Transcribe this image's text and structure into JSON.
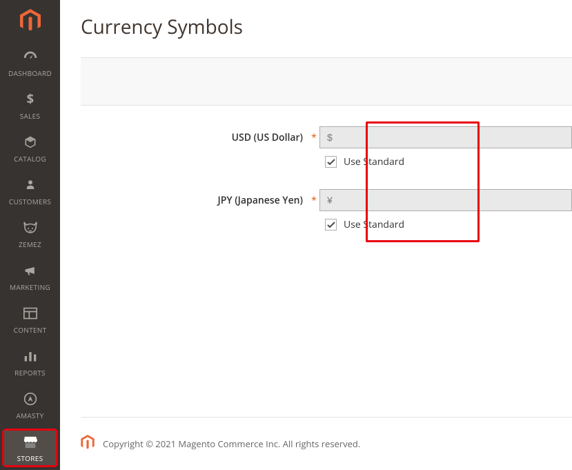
{
  "sidebar": {
    "items": [
      {
        "label": "DASHBOARD"
      },
      {
        "label": "SALES"
      },
      {
        "label": "CATALOG"
      },
      {
        "label": "CUSTOMERS"
      },
      {
        "label": "ZEMEZ"
      },
      {
        "label": "MARKETING"
      },
      {
        "label": "CONTENT"
      },
      {
        "label": "REPORTS"
      },
      {
        "label": "AMASTY"
      },
      {
        "label": "STORES"
      }
    ]
  },
  "page": {
    "title": "Currency Symbols"
  },
  "currencies": [
    {
      "label": "USD (US Dollar)",
      "symbol": "$",
      "use_standard_label": "Use Standard"
    },
    {
      "label": "JPY (Japanese Yen)",
      "symbol": "¥",
      "use_standard_label": "Use Standard"
    }
  ],
  "footer": {
    "copyright": "Copyright © 2021 Magento Commerce Inc. All rights reserved."
  }
}
